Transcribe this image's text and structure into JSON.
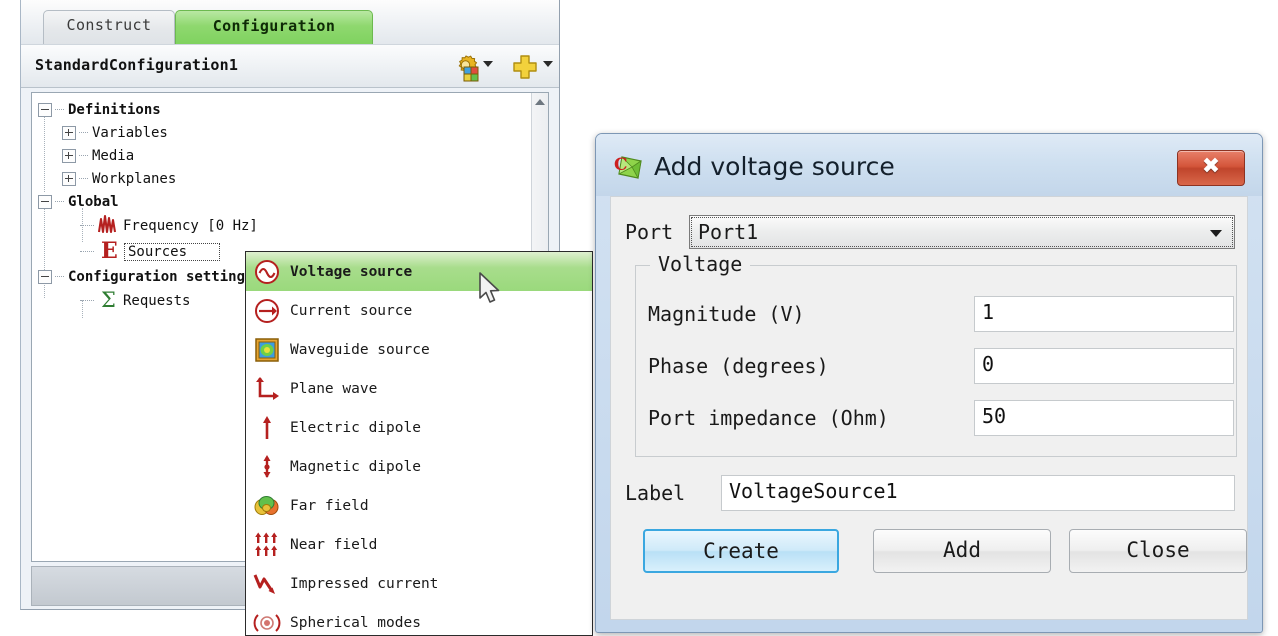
{
  "panel": {
    "tabs": [
      {
        "label": "Construct",
        "active": false
      },
      {
        "label": "Configuration",
        "active": true
      }
    ],
    "toolbar": {
      "config_name": "StandardConfiguration1",
      "gear_icon": "gear-icon",
      "gear_caret_icon": "chevron-down-icon",
      "plus_icon": "plus-icon",
      "plus_caret_icon": "chevron-down-icon"
    },
    "tree": [
      {
        "label": "Definitions",
        "indent": 0,
        "expander": "minus",
        "bold": true,
        "icon": "",
        "selected": false
      },
      {
        "label": "Variables",
        "indent": 1,
        "expander": "plus",
        "bold": false,
        "icon": "",
        "selected": false
      },
      {
        "label": "Media",
        "indent": 1,
        "expander": "plus",
        "bold": false,
        "icon": "",
        "selected": false
      },
      {
        "label": "Workplanes",
        "indent": 1,
        "expander": "plus",
        "bold": false,
        "icon": "",
        "selected": false
      },
      {
        "label": "Global",
        "indent": 0,
        "expander": "minus",
        "bold": true,
        "icon": "",
        "selected": false
      },
      {
        "label": "Frequency [0 Hz]",
        "indent": 2,
        "expander": "none",
        "bold": false,
        "icon": "frequency-icon",
        "selected": false
      },
      {
        "label": "Sources",
        "indent": 2,
        "expander": "none",
        "bold": false,
        "icon": "sources-icon",
        "selected": true
      },
      {
        "label": "Configuration settings",
        "indent": 0,
        "expander": "minus",
        "bold": true,
        "icon": "",
        "selected": false
      },
      {
        "label": "Requests",
        "indent": 2,
        "expander": "none",
        "bold": false,
        "icon": "requests-icon",
        "selected": false
      }
    ]
  },
  "context_menu": {
    "items": [
      {
        "label": "Voltage source",
        "icon": "voltage-source-icon",
        "highlight": true
      },
      {
        "label": "Current source",
        "icon": "current-source-icon",
        "highlight": false
      },
      {
        "label": "Waveguide source",
        "icon": "waveguide-source-icon",
        "highlight": false
      },
      {
        "label": "Plane wave",
        "icon": "plane-wave-icon",
        "highlight": false
      },
      {
        "label": "Electric dipole",
        "icon": "electric-dipole-icon",
        "highlight": false
      },
      {
        "label": "Magnetic dipole",
        "icon": "magnetic-dipole-icon",
        "highlight": false
      },
      {
        "label": "Far field",
        "icon": "far-field-icon",
        "highlight": false
      },
      {
        "label": "Near field",
        "icon": "near-field-icon",
        "highlight": false
      },
      {
        "label": "Impressed current",
        "icon": "impressed-current-icon",
        "highlight": false
      },
      {
        "label": "Spherical modes",
        "icon": "spherical-modes-icon",
        "highlight": false
      }
    ]
  },
  "dialog": {
    "title": "Add voltage source",
    "app_icon": "feko-app-icon",
    "close_icon": "close-icon",
    "close_glyph": "✖",
    "port": {
      "label": "Port",
      "value": "Port1",
      "caret_icon": "chevron-down-icon"
    },
    "voltage_group": {
      "title": "Voltage",
      "fields": [
        {
          "label": "Magnitude (V)",
          "value": "1"
        },
        {
          "label": "Phase (degrees)",
          "value": "0"
        },
        {
          "label": "Port impedance (Ohm)",
          "value": "50"
        }
      ]
    },
    "label_field": {
      "label": "Label",
      "value": "VoltageSource1"
    },
    "buttons": [
      {
        "name": "create",
        "label": "Create",
        "default": true
      },
      {
        "name": "add",
        "label": "Add",
        "default": false
      },
      {
        "name": "close",
        "label": "Close",
        "default": false
      }
    ]
  },
  "colors": {
    "tab_active": "#8fd86f",
    "menu_highlight": "#9ad97c",
    "close_button": "#c0452c",
    "default_button_border": "#3aa7e0",
    "icon_red": "#b5201f",
    "icon_green": "#2f7d32"
  }
}
